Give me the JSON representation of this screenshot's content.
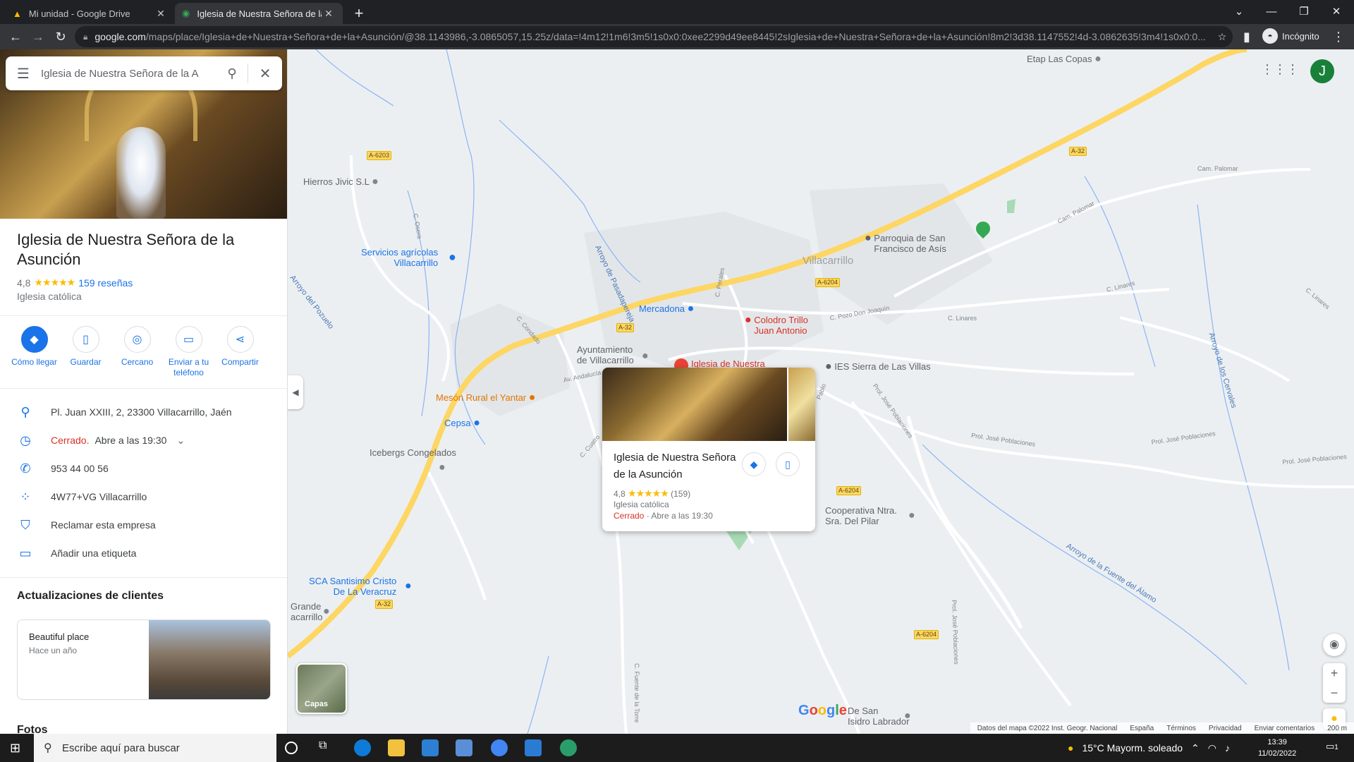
{
  "browser": {
    "tabs": [
      {
        "title": "Mi unidad - Google Drive",
        "icon": "google-drive-icon"
      },
      {
        "title": "Iglesia de Nuestra Señora de la A",
        "icon": "google-maps-icon"
      }
    ],
    "url_domain": "google.com",
    "url_rest": "/maps/place/Iglesia+de+Nuestra+Señora+de+la+Asunción/@38.1143986,-3.0865057,15.25z/data=!4m12!1m6!3m5!1s0x0:0xee2299d49ee8445!2sIglesia+de+Nuestra+Señora+de+la+Asunción!8m2!3d38.1147552!4d-3.0862635!3m4!1s0x0:0...",
    "incognito_label": "Incógnito"
  },
  "search": {
    "value": "Iglesia de Nuestra Señora de la A"
  },
  "place": {
    "name": "Iglesia de Nuestra Señora de la Asunción",
    "rating": "4,8",
    "stars": "★★★★★",
    "reviews": "159 reseñas",
    "category": "Iglesia católica",
    "actions": [
      {
        "label": "Cómo llegar",
        "icon": "directions-icon"
      },
      {
        "label": "Guardar",
        "icon": "bookmark-icon"
      },
      {
        "label": "Cercano",
        "icon": "nearby-icon"
      },
      {
        "label": "Enviar a tu teléfono",
        "icon": "send-to-phone-icon"
      },
      {
        "label": "Compartir",
        "icon": "share-icon"
      }
    ],
    "address": "Pl. Juan XXIII, 2, 23300 Villacarrillo, Jaén",
    "status_closed": "Cerrado.",
    "status_opens": "Abre a las 19:30",
    "phone": "953 44 00 56",
    "plus_code": "4W77+VG Villacarrillo",
    "claim": "Reclamar esta empresa",
    "label": "Añadir una etiqueta"
  },
  "updates": {
    "title": "Actualizaciones de clientes",
    "card_text": "Beautiful place",
    "card_time": "Hace un año"
  },
  "photos_title": "Fotos",
  "map": {
    "pois": {
      "etap": "Etap Las Copas",
      "hierros": "Hierros Jivic S.L",
      "servicios1": "Servicios agrícolas",
      "servicios2": "Villacarrillo",
      "mercadona": "Mercadona",
      "colodro1": "Colodro Trillo",
      "colodro2": "Juan Antonio",
      "ayto1": "Ayuntamiento",
      "ayto2": "de Villacarrillo",
      "iglesia": "Iglesia de Nuestra",
      "meson": "Mesón Rural el Yantar",
      "cepsa": "Cepsa",
      "icebergs": "Icebergs Congelados",
      "ies": "IES Sierra de Las Villas",
      "parroquia1": "Parroquia de San",
      "parroquia2": "Francisco de Asís",
      "villacarrillo": "Villacarrillo",
      "coop1": "Cooperativa Ntra.",
      "coop2": "Sra. Del Pilar",
      "sca1": "SCA Santisimo Cristo",
      "sca2": "De La Veracruz",
      "grande1": "Grande",
      "grande2": "acarrillo",
      "isidro1": "De San",
      "isidro2": "Isidro Labrador"
    },
    "roads": {
      "a6203": "A-6203",
      "a32a": "A-32",
      "a32b": "A-32",
      "a32c": "A-32",
      "a6204a": "A-6204",
      "a6204b": "A-6204",
      "a6204c": "A-6204"
    },
    "creeks": {
      "pasadapereja": "Arroyo de Pasadapereja",
      "pozuelo": "Arroyo del Pozuelo",
      "cervales": "Arroyo de los Cervales",
      "fuente": "Arroyo de la Fuente del Álamo"
    },
    "streets": {
      "palomar1": "Cam. Palomar",
      "palomar2": "Cam. Palomar",
      "linares1": "C. Linares",
      "linares2": "C. Linares",
      "linares3": "C. Linares",
      "pozo": "C. Pozo Don Joaquín",
      "condado": "C. Condado",
      "andalucia": "Av. Andalucía",
      "cuatro": "C. Cuatro",
      "perales": "C. Perales",
      "jose1": "Prol. José Poblaciones",
      "jose2": "Prol. José Poblaciones",
      "jose3": "Prol. José Poblaciones",
      "jose4": "Prol. José Poblaciones",
      "jose5": "Prol. José Poblaciones",
      "torre": "C. Fuente de la Torre",
      "osera": "C. Osera",
      "pablo": "Pablo"
    },
    "layers_label": "Capas",
    "popup": {
      "title": "Iglesia de Nuestra Señora de la Asunción",
      "rating": "4,8",
      "stars": "★★★★★",
      "reviews": "(159)",
      "category": "Iglesia católica",
      "closed": "Cerrado",
      "opens": "· Abre a las 19:30"
    },
    "avatar_letter": "J",
    "attribution": [
      "Datos del mapa ©2022 Inst. Geogr. Nacional",
      "España",
      "Términos",
      "Privacidad",
      "Enviar comentarios",
      "200 m"
    ],
    "google_logo": "Google"
  },
  "taskbar": {
    "search_placeholder": "Escribe aquí para buscar",
    "weather": "15°C  Mayorm. soleado",
    "time": "13:39",
    "date": "11/02/2022",
    "notif_count": "1"
  },
  "colors": {
    "accent": "#1a73e8",
    "closed_red": "#d93025",
    "star_yellow": "#fbbc04",
    "road_yellow": "#fdd663"
  }
}
